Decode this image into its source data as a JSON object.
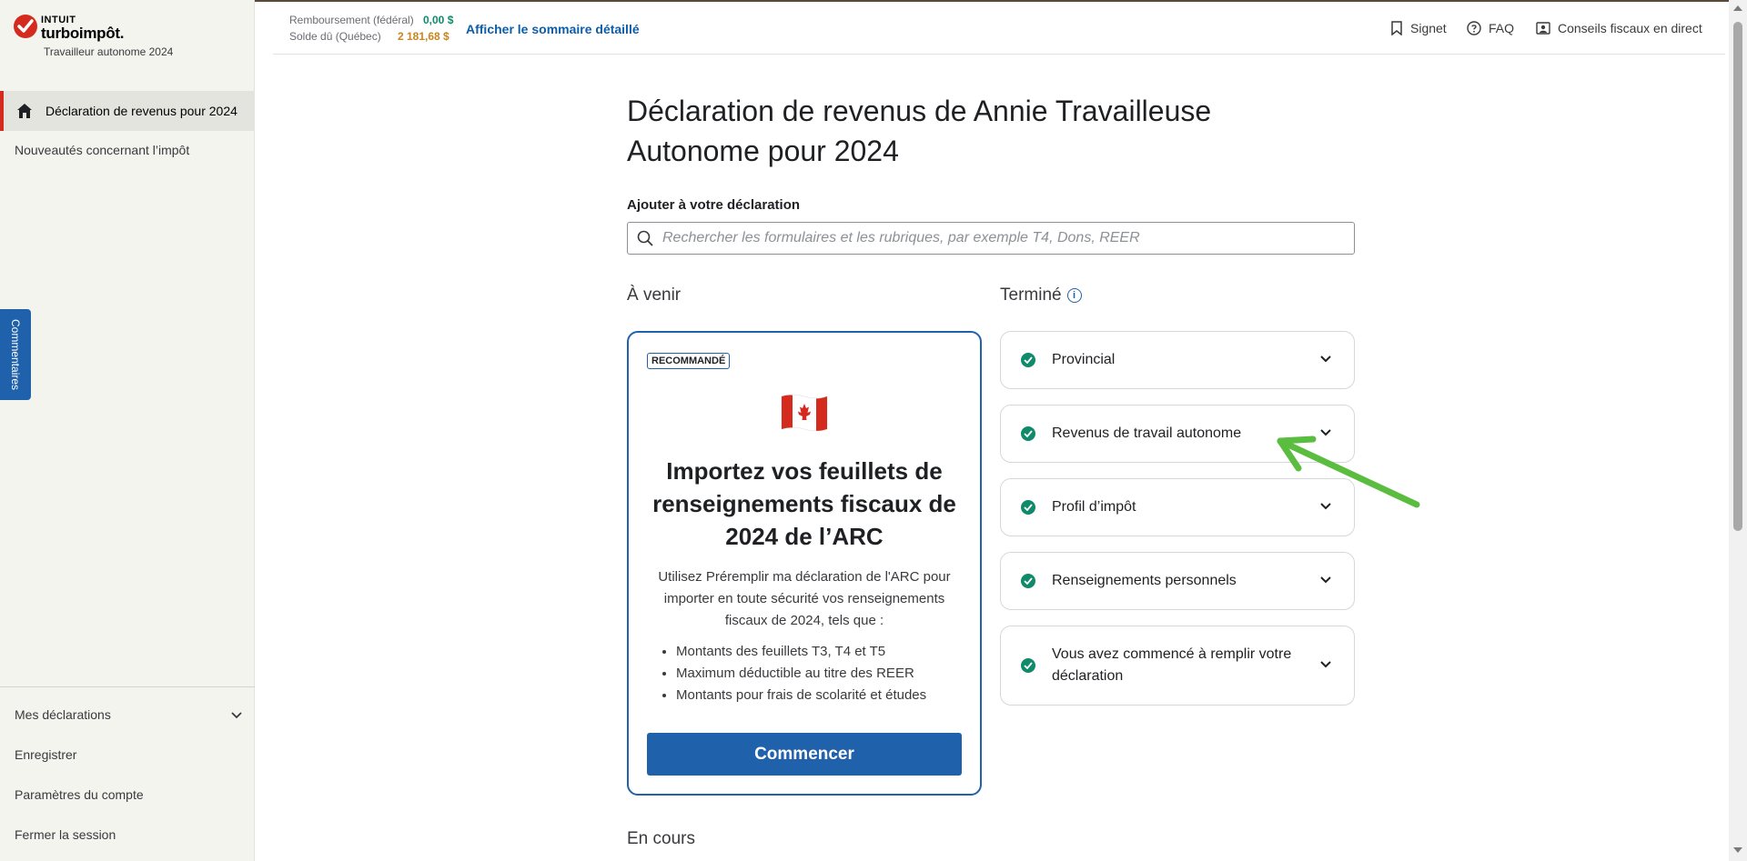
{
  "app": {
    "brand_top": "INTUIT",
    "brand_name": "turboimpôt.",
    "product": "Travailleur autonome 2024",
    "accent_color": "#d52b1e",
    "primary_color": "#2061ab"
  },
  "sidebar": {
    "active_item": "Déclaration de revenus pour 2024",
    "news_item": "Nouveautés concernant l’impôt",
    "bottom_items": [
      "Mes déclarations",
      "Enregistrer",
      "Paramètres du compte",
      "Fermer la session"
    ],
    "comment_tab": "Commentaires"
  },
  "header": {
    "refund_label": "Remboursement (fédéral)",
    "refund_value": "0,00 $",
    "balance_label": "Solde dû (Québec)",
    "balance_value": "2 181,68 $",
    "summary_link": "Afficher le sommaire détaillé",
    "bookmark": "Signet",
    "faq": "FAQ",
    "advice": "Conseils fiscaux en direct"
  },
  "main": {
    "title": "Déclaration de revenus de Annie Travailleuse Autonome pour 2024",
    "add_label": "Ajouter à votre déclaration",
    "search_placeholder": "Rechercher les formulaires et les rubriques, par exemple T4, Dons, REER",
    "upcoming_heading": "À venir",
    "done_heading": "Terminé",
    "in_progress_heading": "En cours"
  },
  "card": {
    "badge": "RECOMMANDÉ",
    "title": "Importez vos feuillets de renseignements fiscaux de 2024 de l’ARC",
    "description": "Utilisez Préremplir ma déclaration de l'ARC pour importer en toute sécurité vos renseignements fiscaux de 2024, tels que :",
    "bullets": [
      "Montants des feuillets T3, T4 et T5",
      "Maximum déductible au titre des REER",
      "Montants pour frais de scolarité et études"
    ],
    "button": "Commencer"
  },
  "completed": [
    "Provincial",
    "Revenus de travail autonome",
    "Profil d’impôt",
    "Renseignements personnels",
    "Vous avez commencé à remplir votre déclaration"
  ]
}
